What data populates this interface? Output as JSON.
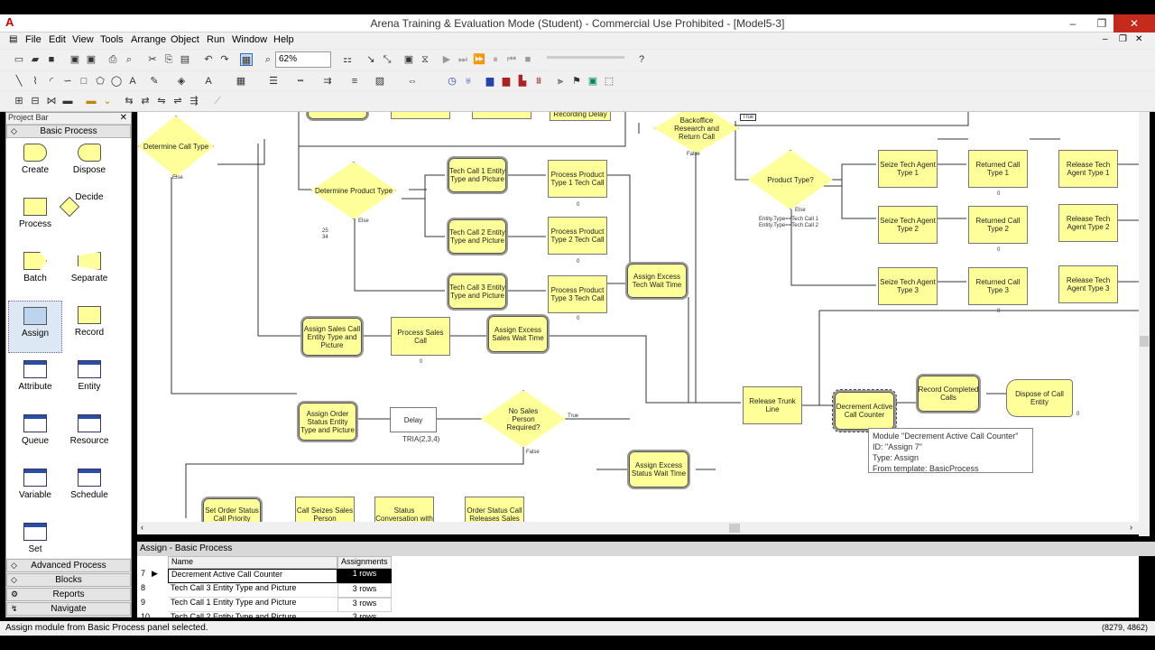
{
  "window": {
    "title": "Arena Training & Evaluation Mode (Student) - Commercial Use Prohibited - [Model5-3]",
    "min": "–",
    "restore": "❐",
    "close": "✕"
  },
  "menu": [
    "File",
    "Edit",
    "View",
    "Tools",
    "Arrange",
    "Object",
    "Run",
    "Window",
    "Help"
  ],
  "toolbar": {
    "zoom": "62%"
  },
  "project_bar": {
    "title": "Project Bar",
    "basic_process": "Basic Process",
    "advanced_process": "Advanced Process",
    "blocks": "Blocks",
    "reports": "Reports",
    "navigate": "Navigate",
    "modules": [
      "Create",
      "Dispose",
      "Process",
      "Decide",
      "Batch",
      "Separate",
      "Assign",
      "Record",
      "Attribute",
      "Entity",
      "Queue",
      "Resource",
      "Variable",
      "Schedule",
      "Set"
    ]
  },
  "canvas": {
    "modules": {
      "determine_call_type": "Determine Call Type",
      "determine_product_type": "Determine Product Type",
      "tech_call_1": "Tech Call 1 Entity Type and Picture",
      "tech_call_2": "Tech Call 2 Entity Type and Picture",
      "tech_call_3": "Tech Call 3 Entity Type and Picture",
      "process_product_1": "Process Product Type 1 Tech Call",
      "process_product_2": "Process Product Type 2 Tech Call",
      "process_product_3": "Process Product Type 3 Tech Call",
      "assign_excess_tech": "Assign Excess Tech Wait Time",
      "assign_sales_call": "Assign Sales Call Entity Type and Picture",
      "process_sales_call": "Process Sales Call",
      "assign_excess_sales": "Assign Excess Sales Wait Time",
      "assign_order_status": "Assign Order Status Entity Type and Picture",
      "delay": "Delay",
      "delay_expr": "TRIA(2,3,4)",
      "no_sales_person": "No Sales Person Required?",
      "assign_excess_status": "Assign Excess Status Wait Time",
      "set_order_status": "Set Order Status Call Priority",
      "call_seizes_sales": "Call Seizes Sales Person",
      "status_conversation": "Status Conversation with",
      "order_status_call": "Order Status Call Releases Sales",
      "backoffice": "Backoffice Research and Return Call",
      "product_type": "Product Type?",
      "seize_tech_1": "Seize Tech Agent Type 1",
      "seize_tech_2": "Seize Tech Agent Type 2",
      "seize_tech_3": "Seize Tech Agent Type 3",
      "returned_call_1": "Returned Call Type 1",
      "returned_call_2": "Returned Call Type 2",
      "returned_call_3": "Returned Call Type 3",
      "release_tech_1": "Release Tech Agent Type 1",
      "release_tech_2": "Release Tech Agent Type 2",
      "release_tech_3": "Release Tech Agent Type 3",
      "release_trunk": "Release Trunk Line",
      "decrement": "Decrement Active Call Counter",
      "record_completed": "Record Completed Calls",
      "dispose_call": "Dispose of Call Entity",
      "recording_delay": "Recording Delay"
    },
    "labels": {
      "else": "Else",
      "true": "True",
      "false": "False",
      "zero": "0",
      "n25": "25",
      "n34": "34",
      "entity_type_1": "Entity.Type==Tech Call 1",
      "entity_type_2": "Entity.Type==Tech Call 2"
    }
  },
  "tooltip": {
    "line1": "Module \"Decrement Active Call Counter\"",
    "line2": "ID: \"Assign 7\"",
    "line3": "Type: Assign",
    "line4": "From template: BasicProcess"
  },
  "spreadsheet": {
    "title": "Assign - Basic Process",
    "col_name": "Name",
    "col_assign": "Assignments",
    "rows": [
      {
        "n": "7",
        "name": "Decrement Active Call Counter",
        "val": "1 rows"
      },
      {
        "n": "8",
        "name": "Tech Call 3 Entity Type and Picture",
        "val": "3 rows"
      },
      {
        "n": "9",
        "name": "Tech Call 1 Entity Type and Picture",
        "val": "3 rows"
      },
      {
        "n": "10",
        "name": "Tech Call 2 Entity Type and Picture",
        "val": "3 rows"
      }
    ]
  },
  "status": {
    "message": "Assign module from Basic Process panel selected.",
    "coords": "(8279, 4862)"
  }
}
